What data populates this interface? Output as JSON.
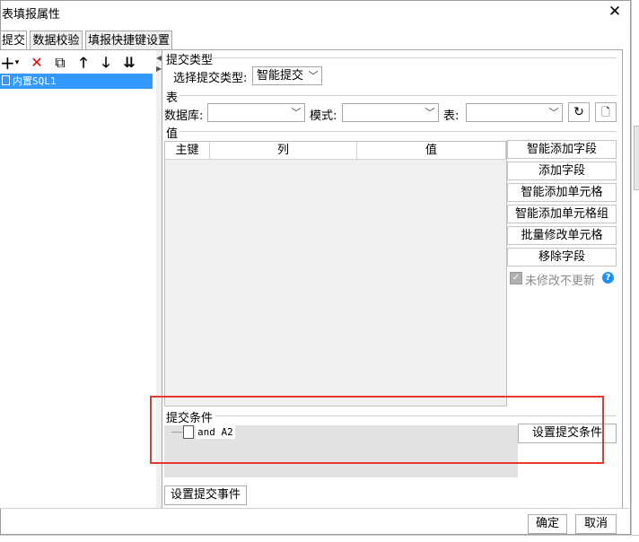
{
  "window": {
    "title": "表填报属性",
    "close_label": "✕"
  },
  "tabs": [
    {
      "label": "提交"
    },
    {
      "label": "数据校验"
    },
    {
      "label": "填报快捷键设置"
    }
  ],
  "toolbar": {
    "add": "+",
    "add_caret": "▾",
    "delete": "✕",
    "copy": "⧉",
    "up": "🡑",
    "down": "🡓",
    "move_bottom": "⇊"
  },
  "tree": {
    "items": [
      {
        "label": "内置SQL1"
      }
    ]
  },
  "submit_type": {
    "section_title": "提交类型",
    "label": "选择提交类型:",
    "value": "智能提交"
  },
  "table": {
    "section_title": "表",
    "database_label": "数据库:",
    "database_value": "",
    "schema_label": "模式:",
    "schema_value": "",
    "table_label": "表:",
    "table_value": ""
  },
  "values": {
    "section_title": "值",
    "columns": [
      "主键",
      "列",
      "值"
    ]
  },
  "side_buttons": [
    "智能添加字段",
    "添加字段",
    "智能添加单元格",
    "智能添加单元格组",
    "批量修改单元格",
    "移除字段"
  ],
  "no_update_unchanged": {
    "label": "未修改不更新",
    "checked": true
  },
  "submit_condition": {
    "section_title": "提交条件",
    "condition_text": "and  A2",
    "set_button": "设置提交条件"
  },
  "submit_event_button": "设置提交事件",
  "footer": {
    "ok": "确定",
    "cancel": "取消"
  },
  "colors": {
    "selection": "#3399ff",
    "highlight_box": "#e53935",
    "help_icon": "#1e90ff",
    "delete_icon": "#e00000"
  }
}
